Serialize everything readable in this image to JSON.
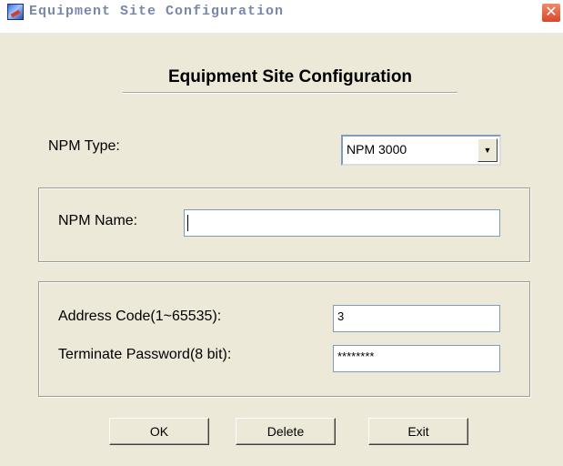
{
  "window": {
    "title": "Equipment Site Configuration",
    "close_glyph": "✕",
    "app_icon": "app-icon"
  },
  "form": {
    "heading": "Equipment Site Configuration",
    "npm_type": {
      "label": "NPM Type:",
      "selected": "NPM 3000",
      "arrow": "▼"
    },
    "npm_name": {
      "label": "NPM Name:",
      "value": ""
    },
    "address_code": {
      "label": "Address Code(1~65535):",
      "value": "3"
    },
    "terminate_password": {
      "label": "Terminate Password(8 bit):",
      "value": "********"
    }
  },
  "buttons": {
    "ok": "OK",
    "delete": "Delete",
    "exit": "Exit"
  },
  "colors": {
    "dialog_background": "#ece9d8",
    "close_button": "#d8472c",
    "title_text": "#7a86a8"
  }
}
